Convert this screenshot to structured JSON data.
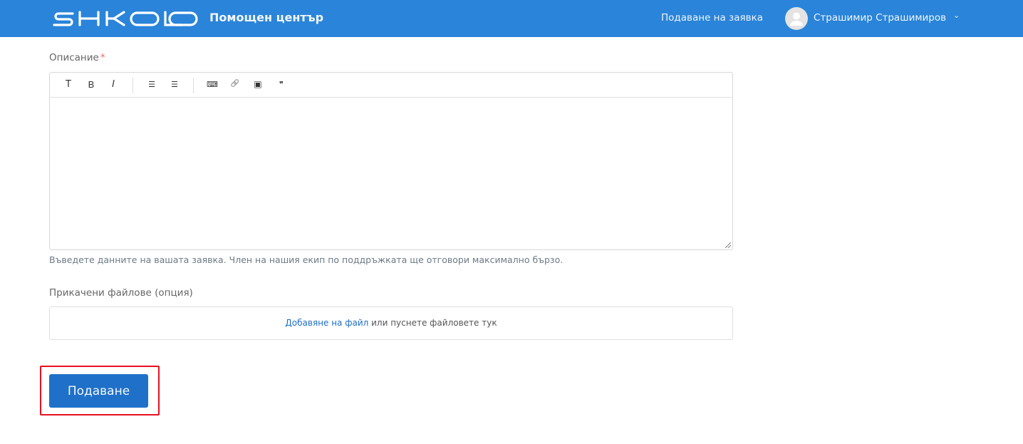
{
  "header": {
    "logo_text": "SHKOLO",
    "title": "Помощен център",
    "nav_link": "Подаване на заявка",
    "user_name": "Страшимир Страшимиров",
    "chevron": "⌄"
  },
  "form": {
    "description_label": "Описание",
    "required_mark": "*",
    "toolbar": [
      {
        "name": "text-style",
        "glyph": "T"
      },
      {
        "name": "bold",
        "glyph": "B"
      },
      {
        "name": "italic",
        "glyph": "I"
      },
      {
        "name": "bullet-list",
        "glyph": "☰"
      },
      {
        "name": "numbered-list",
        "glyph": "☰"
      },
      {
        "name": "code",
        "glyph": "⌨"
      },
      {
        "name": "link",
        "glyph": "🔗"
      },
      {
        "name": "image",
        "glyph": "▣"
      },
      {
        "name": "quote",
        "glyph": "❞"
      }
    ],
    "description_value": "",
    "help_text": "Въведете данните на вашата заявка. Член на нашия екип по поддръжката ще отговори максимално бързо.",
    "attachments_label": "Прикачени файлове (опция)",
    "add_file_link": "Добавяне на файл",
    "drop_text": " или пуснете файловете тук",
    "submit_label": "Подаване"
  }
}
